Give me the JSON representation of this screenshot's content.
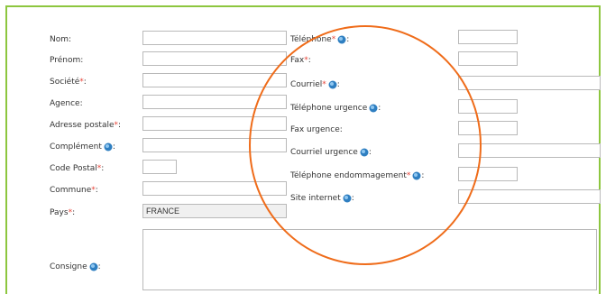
{
  "colors": {
    "accent_green": "#8dc63f",
    "required_star": "#e8463a",
    "annotation": "#ef6c1a"
  },
  "left_fields": [
    {
      "label": "Nom",
      "required": false,
      "info": false,
      "value": ""
    },
    {
      "label": "Prénom",
      "required": false,
      "info": false,
      "value": ""
    },
    {
      "label": "Société",
      "required": true,
      "info": false,
      "value": ""
    },
    {
      "label": "Agence",
      "required": false,
      "info": false,
      "value": ""
    },
    {
      "label": "Adresse postale",
      "required": true,
      "info": false,
      "value": ""
    },
    {
      "label": "Complément",
      "required": false,
      "info": true,
      "value": ""
    },
    {
      "label": "Code Postal",
      "required": true,
      "info": false,
      "value": ""
    },
    {
      "label": "Commune",
      "required": true,
      "info": false,
      "value": ""
    },
    {
      "label": "Pays",
      "required": true,
      "info": false,
      "value": "FRANCE"
    },
    {
      "label": "Consigne",
      "required": false,
      "info": true,
      "value": ""
    }
  ],
  "right_fields": [
    {
      "label": "Téléphone",
      "required": true,
      "info": true,
      "value": ""
    },
    {
      "label": "Fax",
      "required": true,
      "info": false,
      "value": ""
    },
    {
      "label": "Courriel",
      "required": true,
      "info": true,
      "value": ""
    },
    {
      "label": "Téléphone urgence",
      "required": false,
      "info": true,
      "value": ""
    },
    {
      "label": "Fax urgence",
      "required": false,
      "info": false,
      "value": ""
    },
    {
      "label": "Courriel urgence",
      "required": false,
      "info": true,
      "value": ""
    },
    {
      "label": "Téléphone endommagement",
      "required": true,
      "info": true,
      "value": ""
    },
    {
      "label": "Site internet",
      "required": false,
      "info": true,
      "value": ""
    }
  ],
  "icons": {
    "info": "info-globe-icon"
  }
}
